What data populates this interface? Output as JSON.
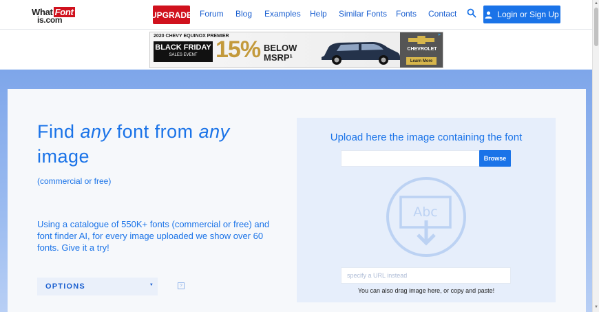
{
  "header": {
    "logo": {
      "line1_a": "What",
      "line1_b": "Font",
      "line2": "is.com"
    },
    "upgrade_label": "UPGRADE",
    "nav": [
      {
        "label": "Forum"
      },
      {
        "label": "Blog"
      },
      {
        "label": "Examples"
      },
      {
        "label": "Help"
      },
      {
        "label": "Similar Fonts"
      },
      {
        "label": "Fonts"
      },
      {
        "label": "Contact"
      }
    ],
    "search_icon": "search-icon",
    "login_label": "Login or Sign Up",
    "login_icon": "user-icon"
  },
  "ad": {
    "top_text": "2020 CHEVY EQUINOX PREMIER",
    "black_friday": "BLACK FRIDAY",
    "sales_event": "SALES EVENT",
    "percent": "15%",
    "below": "BELOW",
    "msrp": "MSRP¹",
    "brand": "CHEVROLET",
    "cta": "Learn More"
  },
  "main": {
    "headline_parts": [
      "Find ",
      "any",
      " font from ",
      "any",
      " image"
    ],
    "subtitle": "(commercial or free)",
    "description": "Using a catalogue of 550K+ fonts (commercial or free) and font finder AI, for every image uploaded we show over 60 fonts. Give it a try!",
    "options_label": "OPTIONS",
    "help_label": "?"
  },
  "upload": {
    "title": "Upload here the image containing the font",
    "browse_label": "Browse",
    "icon_text": "Abc",
    "url_placeholder": "specify a URL instead",
    "drag_hint": "You can also drag image here, or copy and paste!"
  },
  "colors": {
    "accent": "#1a73e8",
    "upgrade": "#d0111d",
    "band": "#7ea6ea",
    "panel": "#e6eefb"
  }
}
